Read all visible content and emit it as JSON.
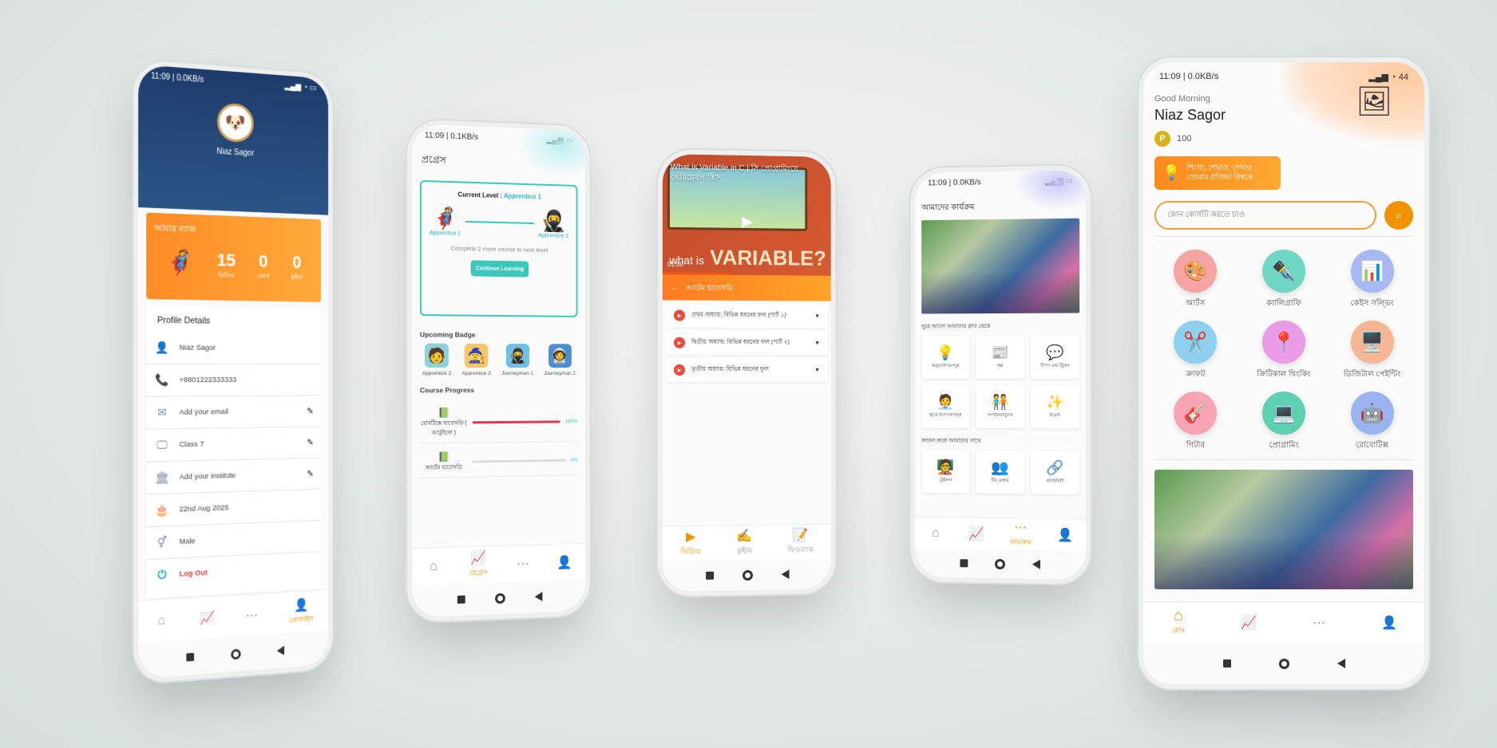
{
  "phone1": {
    "status": "11:09 | 0.0KB/s",
    "user_name": "Niaz Sagor",
    "badge_title": "আমার ব্যাজ",
    "stats": [
      {
        "num": "15",
        "label": "ভিডিও"
      },
      {
        "num": "0",
        "label": "কোর্স"
      },
      {
        "num": "0",
        "label": "কুইজ"
      }
    ],
    "profile_title": "Profile Details",
    "rows": [
      {
        "icon": "user-icon",
        "glyph": "👤",
        "text": "Niaz Sagor",
        "editable": false
      },
      {
        "icon": "phone-icon",
        "glyph": "📞",
        "text": "+8801222333333",
        "editable": false
      },
      {
        "icon": "email-icon",
        "glyph": "✉",
        "text": "Add your email",
        "editable": true
      },
      {
        "icon": "class-icon",
        "glyph": "🖵",
        "text": "Class 7",
        "editable": true
      },
      {
        "icon": "institute-icon",
        "glyph": "🏛",
        "text": "Add your institute",
        "editable": true
      },
      {
        "icon": "birthday-icon",
        "glyph": "🎂",
        "text": "22nd Aug 2025",
        "editable": false
      },
      {
        "icon": "gender-icon",
        "glyph": "⚥",
        "text": "Male",
        "editable": false
      }
    ],
    "logout": "Log Out",
    "nav_active": "প্রোফাইল"
  },
  "phone2": {
    "status": "11:09 | 0.1KB/s",
    "title": "প্রগ্রেস",
    "current_level_label": "Current Level : ",
    "current_level": "Apprentice 1",
    "level_from": "Apprentice 1",
    "level_to": "Apprentice 2",
    "complete_text": "Complete 2 more course to next level",
    "continue_btn": "Continue Learning",
    "upcoming_title": "Upcoming Badge",
    "upcoming": [
      "Apprentice 2",
      "Apprentice 3",
      "Journeyman 1",
      "Journeyman 2"
    ],
    "course_progress_title": "Course Progress",
    "courses": [
      {
        "name": "রোবটিক্সে হাতেখড়ি ( আর্ডুইনো )",
        "pct": 100,
        "pct_label": "100%"
      },
      {
        "name": "আর্টের হাতেখড়ি",
        "pct": 0,
        "pct_label": "0%"
      }
    ],
    "nav_active": "প্রগ্রেস"
  },
  "phone3": {
    "video_title": "What is Variable in C | সি প্রোগ্রামিংয়ে ভেরিয়েবল কি?",
    "video_time": "01:00",
    "video_big_small": "what is",
    "video_big": "VARIABLE?",
    "course_title": "আর্টের হাতেখড়ি",
    "chapters": [
      "প্রথম অধ্যায়: বিভিন্ন ধরনের ফল (পার্ট ১)",
      "দ্বিতীয় অধ্যায়: বিভিন্ন ধরনের ফল (পার্ট ২)",
      "তৃতীয় অধ্যায়: বিভিন্ন ধরনের ফুল"
    ],
    "nav": [
      "ভিডিও",
      "কুইজ",
      "ফিডব্যাক"
    ]
  },
  "phone4": {
    "status": "11:09 | 0.0KB/s",
    "title": "আমাদের কার্যক্রম",
    "sub1": "ঘুরে আসো আমাদের ক্লাব থেকে",
    "clubs": [
      {
        "label": "অনুরোধপত্রসমূহ",
        "glyph": "💡"
      },
      {
        "label": "গল্প",
        "glyph": "📰"
      },
      {
        "label": "টিপস এন্ড ট্রিকস",
        "glyph": "💬"
      },
      {
        "label": "ক্ষুদ্রে উদ্যোক্তাসমূহ",
        "glyph": "🧑‍💼"
      },
      {
        "label": "সংগঠকবাবুদের",
        "glyph": "🧑‍🤝‍🧑"
      },
      {
        "label": "ইভেন্ট",
        "glyph": "✨"
      }
    ],
    "sub2": "জয়েন করো আমাদের সাথে",
    "joins": [
      {
        "label": "ট্রেইনার",
        "glyph": "🧑‍🏫"
      },
      {
        "label": "টিম মেম্বার",
        "glyph": "👥"
      },
      {
        "label": "কমিউনিটি",
        "glyph": "🔗"
      }
    ],
    "nav_active": "কার্যক্রম"
  },
  "phone5": {
    "status": "11:09 | 0.0KB/s",
    "battery": "44",
    "greeting": "Good Morning",
    "user_name": "Niaz Sagor",
    "points": "100",
    "slogan": "শিখো, শেখাও, দেখাও তোমার প্রতিভা বিশ্বকে",
    "search_placeholder": "কোন কোর্সটি করতে চাও",
    "categories": [
      {
        "label": "আর্টস",
        "glyph": "🎨",
        "color": "#f6a3a3"
      },
      {
        "label": "ক্যালিগ্রাফি",
        "glyph": "✒️",
        "color": "#6fd6c4"
      },
      {
        "label": "কেইস সল্ভিং",
        "glyph": "📊",
        "color": "#a8b8f5"
      },
      {
        "label": "ক্রাফট",
        "glyph": "✂️",
        "color": "#8fd0f0"
      },
      {
        "label": "ক্রিটিকাল থিংকিং",
        "glyph": "📍",
        "color": "#e99be6"
      },
      {
        "label": "ডিজিটাল পেইন্টিং",
        "glyph": "🖥️",
        "color": "#f5b793"
      },
      {
        "label": "গিটার",
        "glyph": "🎸",
        "color": "#f7a4b4"
      },
      {
        "label": "প্রোগ্রামিং",
        "glyph": "💻",
        "color": "#5fcfb1"
      },
      {
        "label": "রোবোটিক্স",
        "glyph": "🤖",
        "color": "#9ab4f2"
      }
    ],
    "nav_home": "হোম"
  }
}
